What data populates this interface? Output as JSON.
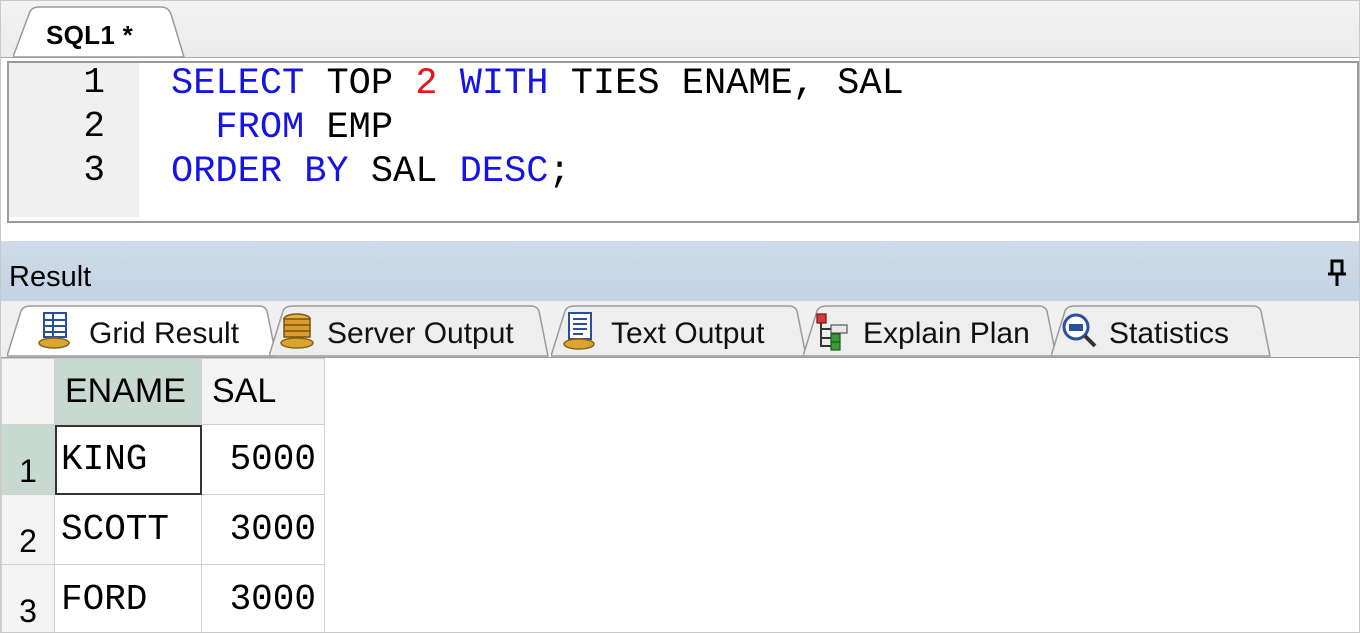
{
  "editor": {
    "tab_label": "SQL1 *",
    "line_numbers": [
      "1",
      "2",
      "3"
    ],
    "lines": [
      [
        {
          "text": "SELECT ",
          "kind": "kw"
        },
        {
          "text": "TOP ",
          "kind": "txt"
        },
        {
          "text": "2 ",
          "kind": "num"
        },
        {
          "text": "WITH ",
          "kind": "kw"
        },
        {
          "text": "TIES ENAME, SAL",
          "kind": "txt"
        }
      ],
      [
        {
          "text": "  ",
          "kind": "txt"
        },
        {
          "text": "FROM ",
          "kind": "kw"
        },
        {
          "text": "EMP",
          "kind": "txt"
        }
      ],
      [
        {
          "text": "ORDER BY ",
          "kind": "kw"
        },
        {
          "text": "SAL ",
          "kind": "txt"
        },
        {
          "text": "DESC",
          "kind": "kw"
        },
        {
          "text": ";",
          "kind": "txt"
        }
      ]
    ],
    "colors": {
      "keyword": "#1414e6",
      "number": "#e61414",
      "text": "#000000"
    }
  },
  "result": {
    "title": "Result",
    "pin_icon": "pin-icon",
    "tabs": [
      {
        "label": "Grid Result",
        "icon": "grid-result-icon",
        "active": true
      },
      {
        "label": "Server Output",
        "icon": "server-output-icon",
        "active": false
      },
      {
        "label": "Text Output",
        "icon": "text-output-icon",
        "active": false
      },
      {
        "label": "Explain Plan",
        "icon": "explain-plan-icon",
        "active": false
      },
      {
        "label": "Statistics",
        "icon": "statistics-icon",
        "active": false
      }
    ],
    "grid": {
      "columns": [
        "ENAME",
        "SAL"
      ],
      "rows": [
        {
          "num": "1",
          "ename": "KING",
          "sal": "5000"
        },
        {
          "num": "2",
          "ename": "SCOTT",
          "sal": "3000"
        },
        {
          "num": "3",
          "ename": "FORD",
          "sal": "3000"
        }
      ],
      "selected_row": 1,
      "selection_color": "#c7d9d0"
    }
  }
}
